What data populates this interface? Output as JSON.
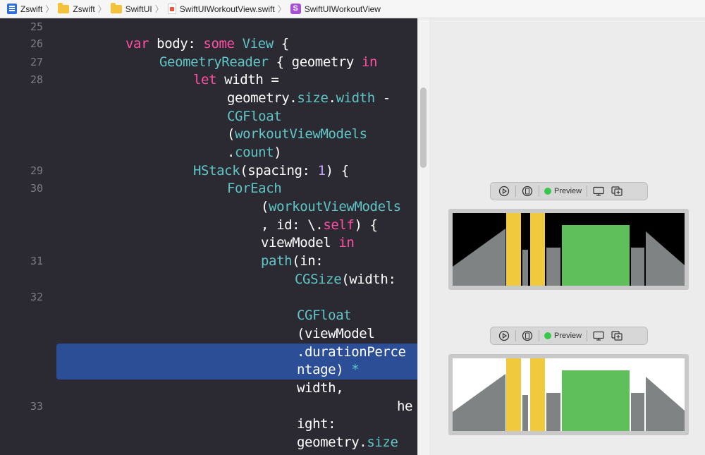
{
  "breadcrumb": [
    {
      "label": "Zswift",
      "icon": "project-icon"
    },
    {
      "label": "Zswift",
      "icon": "folder-icon"
    },
    {
      "label": "SwiftUI",
      "icon": "folder-icon"
    },
    {
      "label": "SwiftUIWorkoutView.swift",
      "icon": "swift-file-icon"
    },
    {
      "label": "SwiftUIWorkoutView",
      "icon": "struct-icon"
    }
  ],
  "editor": {
    "line_numbers": [
      "25",
      "26",
      "27",
      "28",
      "29",
      "30",
      "31",
      "32",
      "33"
    ],
    "code": [
      "var body: some View {",
      "GeometryReader { geometry in",
      "let width =",
      "geometry.size.width -",
      "CGFloat",
      "(workoutViewModels",
      ".count)",
      "HStack(spacing: 1) {",
      "ForEach",
      "(workoutViewModels",
      ", id: \\.self) {",
      "viewModel in",
      "path(in:",
      "CGSize(width:",
      "CGFloat",
      "(viewModel",
      ".durationPerce",
      "ntage) *",
      "width,",
      "he",
      "ight:",
      "geometry.size"
    ]
  },
  "previews": [
    {
      "label": "Preview",
      "background": "#000000"
    },
    {
      "label": "Preview",
      "background": "#ffffff"
    }
  ],
  "colors": {
    "keyword": "#ff4fa3",
    "type": "#5fc6c5",
    "editor_bg": "#2b2a33",
    "selection": "#2c4e96",
    "bar_gray": "#808383",
    "bar_yellow": "#f0c93c",
    "bar_green": "#5fbf5a",
    "live_dot": "#37c84b"
  }
}
